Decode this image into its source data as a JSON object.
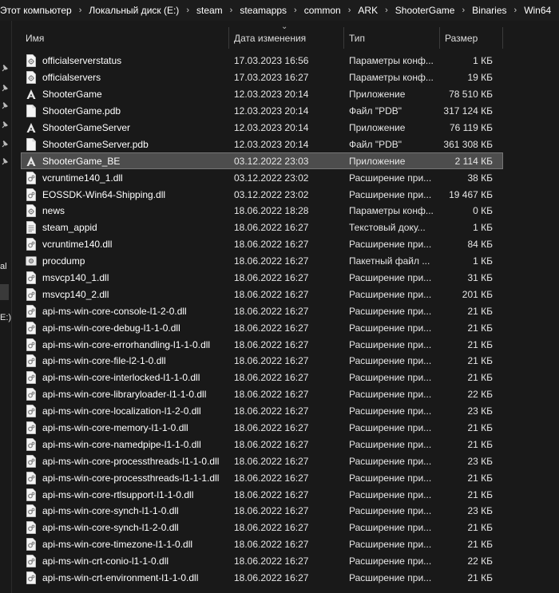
{
  "breadcrumb": [
    "Этот компьютер",
    "Локальный диск (E:)",
    "steam",
    "steamapps",
    "common",
    "ARK",
    "ShooterGame",
    "Binaries",
    "Win64"
  ],
  "nav_fragments": [
    "al",
    "E:)"
  ],
  "columns": {
    "name": "Имя",
    "date": "Дата изменения",
    "type": "Тип",
    "size": "Размер"
  },
  "files": [
    {
      "name": "officialserverstatus",
      "date": "17.03.2023 16:56",
      "type": "Параметры конф...",
      "size": "1 КБ",
      "icon": "config-file-icon"
    },
    {
      "name": "officialservers",
      "date": "17.03.2023 16:27",
      "type": "Параметры конф...",
      "size": "19 КБ",
      "icon": "config-file-icon"
    },
    {
      "name": "ShooterGame",
      "date": "12.03.2023 20:14",
      "type": "Приложение",
      "size": "78 510 КБ",
      "icon": "ark-app-icon"
    },
    {
      "name": "ShooterGame.pdb",
      "date": "12.03.2023 20:14",
      "type": "Файл \"PDB\"",
      "size": "317 124 КБ",
      "icon": "blank-file-icon"
    },
    {
      "name": "ShooterGameServer",
      "date": "12.03.2023 20:14",
      "type": "Приложение",
      "size": "76 119 КБ",
      "icon": "ark-app-icon"
    },
    {
      "name": "ShooterGameServer.pdb",
      "date": "12.03.2023 20:14",
      "type": "Файл \"PDB\"",
      "size": "361 308 КБ",
      "icon": "blank-file-icon"
    },
    {
      "name": "ShooterGame_BE",
      "date": "03.12.2022 23:03",
      "type": "Приложение",
      "size": "2 114 КБ",
      "icon": "ark-app-icon",
      "selected": true
    },
    {
      "name": "vcruntime140_1.dll",
      "date": "03.12.2022 23:02",
      "type": "Расширение при...",
      "size": "38 КБ",
      "icon": "dll-file-icon"
    },
    {
      "name": "EOSSDK-Win64-Shipping.dll",
      "date": "03.12.2022 23:02",
      "type": "Расширение при...",
      "size": "19 467 КБ",
      "icon": "dll-file-icon"
    },
    {
      "name": "news",
      "date": "18.06.2022 18:28",
      "type": "Параметры конф...",
      "size": "0 КБ",
      "icon": "config-file-icon"
    },
    {
      "name": "steam_appid",
      "date": "18.06.2022 16:27",
      "type": "Текстовый доку...",
      "size": "1 КБ",
      "icon": "text-file-icon"
    },
    {
      "name": "vcruntime140.dll",
      "date": "18.06.2022 16:27",
      "type": "Расширение при...",
      "size": "84 КБ",
      "icon": "dll-file-icon"
    },
    {
      "name": "procdump",
      "date": "18.06.2022 16:27",
      "type": "Пакетный файл ...",
      "size": "1 КБ",
      "icon": "batch-file-icon"
    },
    {
      "name": "msvcp140_1.dll",
      "date": "18.06.2022 16:27",
      "type": "Расширение при...",
      "size": "31 КБ",
      "icon": "dll-file-icon"
    },
    {
      "name": "msvcp140_2.dll",
      "date": "18.06.2022 16:27",
      "type": "Расширение при...",
      "size": "201 КБ",
      "icon": "dll-file-icon"
    },
    {
      "name": "api-ms-win-core-console-l1-2-0.dll",
      "date": "18.06.2022 16:27",
      "type": "Расширение при...",
      "size": "21 КБ",
      "icon": "dll-file-icon"
    },
    {
      "name": "api-ms-win-core-debug-l1-1-0.dll",
      "date": "18.06.2022 16:27",
      "type": "Расширение при...",
      "size": "21 КБ",
      "icon": "dll-file-icon"
    },
    {
      "name": "api-ms-win-core-errorhandling-l1-1-0.dll",
      "date": "18.06.2022 16:27",
      "type": "Расширение при...",
      "size": "21 КБ",
      "icon": "dll-file-icon"
    },
    {
      "name": "api-ms-win-core-file-l2-1-0.dll",
      "date": "18.06.2022 16:27",
      "type": "Расширение при...",
      "size": "21 КБ",
      "icon": "dll-file-icon"
    },
    {
      "name": "api-ms-win-core-interlocked-l1-1-0.dll",
      "date": "18.06.2022 16:27",
      "type": "Расширение при...",
      "size": "21 КБ",
      "icon": "dll-file-icon"
    },
    {
      "name": "api-ms-win-core-libraryloader-l1-1-0.dll",
      "date": "18.06.2022 16:27",
      "type": "Расширение при...",
      "size": "22 КБ",
      "icon": "dll-file-icon"
    },
    {
      "name": "api-ms-win-core-localization-l1-2-0.dll",
      "date": "18.06.2022 16:27",
      "type": "Расширение при...",
      "size": "23 КБ",
      "icon": "dll-file-icon"
    },
    {
      "name": "api-ms-win-core-memory-l1-1-0.dll",
      "date": "18.06.2022 16:27",
      "type": "Расширение при...",
      "size": "21 КБ",
      "icon": "dll-file-icon"
    },
    {
      "name": "api-ms-win-core-namedpipe-l1-1-0.dll",
      "date": "18.06.2022 16:27",
      "type": "Расширение при...",
      "size": "21 КБ",
      "icon": "dll-file-icon"
    },
    {
      "name": "api-ms-win-core-processthreads-l1-1-0.dll",
      "date": "18.06.2022 16:27",
      "type": "Расширение при...",
      "size": "23 КБ",
      "icon": "dll-file-icon"
    },
    {
      "name": "api-ms-win-core-processthreads-l1-1-1.dll",
      "date": "18.06.2022 16:27",
      "type": "Расширение при...",
      "size": "21 КБ",
      "icon": "dll-file-icon"
    },
    {
      "name": "api-ms-win-core-rtlsupport-l1-1-0.dll",
      "date": "18.06.2022 16:27",
      "type": "Расширение при...",
      "size": "21 КБ",
      "icon": "dll-file-icon"
    },
    {
      "name": "api-ms-win-core-synch-l1-1-0.dll",
      "date": "18.06.2022 16:27",
      "type": "Расширение при...",
      "size": "23 КБ",
      "icon": "dll-file-icon"
    },
    {
      "name": "api-ms-win-core-synch-l1-2-0.dll",
      "date": "18.06.2022 16:27",
      "type": "Расширение при...",
      "size": "21 КБ",
      "icon": "dll-file-icon"
    },
    {
      "name": "api-ms-win-core-timezone-l1-1-0.dll",
      "date": "18.06.2022 16:27",
      "type": "Расширение при...",
      "size": "21 КБ",
      "icon": "dll-file-icon"
    },
    {
      "name": "api-ms-win-crt-conio-l1-1-0.dll",
      "date": "18.06.2022 16:27",
      "type": "Расширение при...",
      "size": "22 КБ",
      "icon": "dll-file-icon"
    },
    {
      "name": "api-ms-win-crt-environment-l1-1-0.dll",
      "date": "18.06.2022 16:27",
      "type": "Расширение при...",
      "size": "21 КБ",
      "icon": "dll-file-icon"
    }
  ]
}
